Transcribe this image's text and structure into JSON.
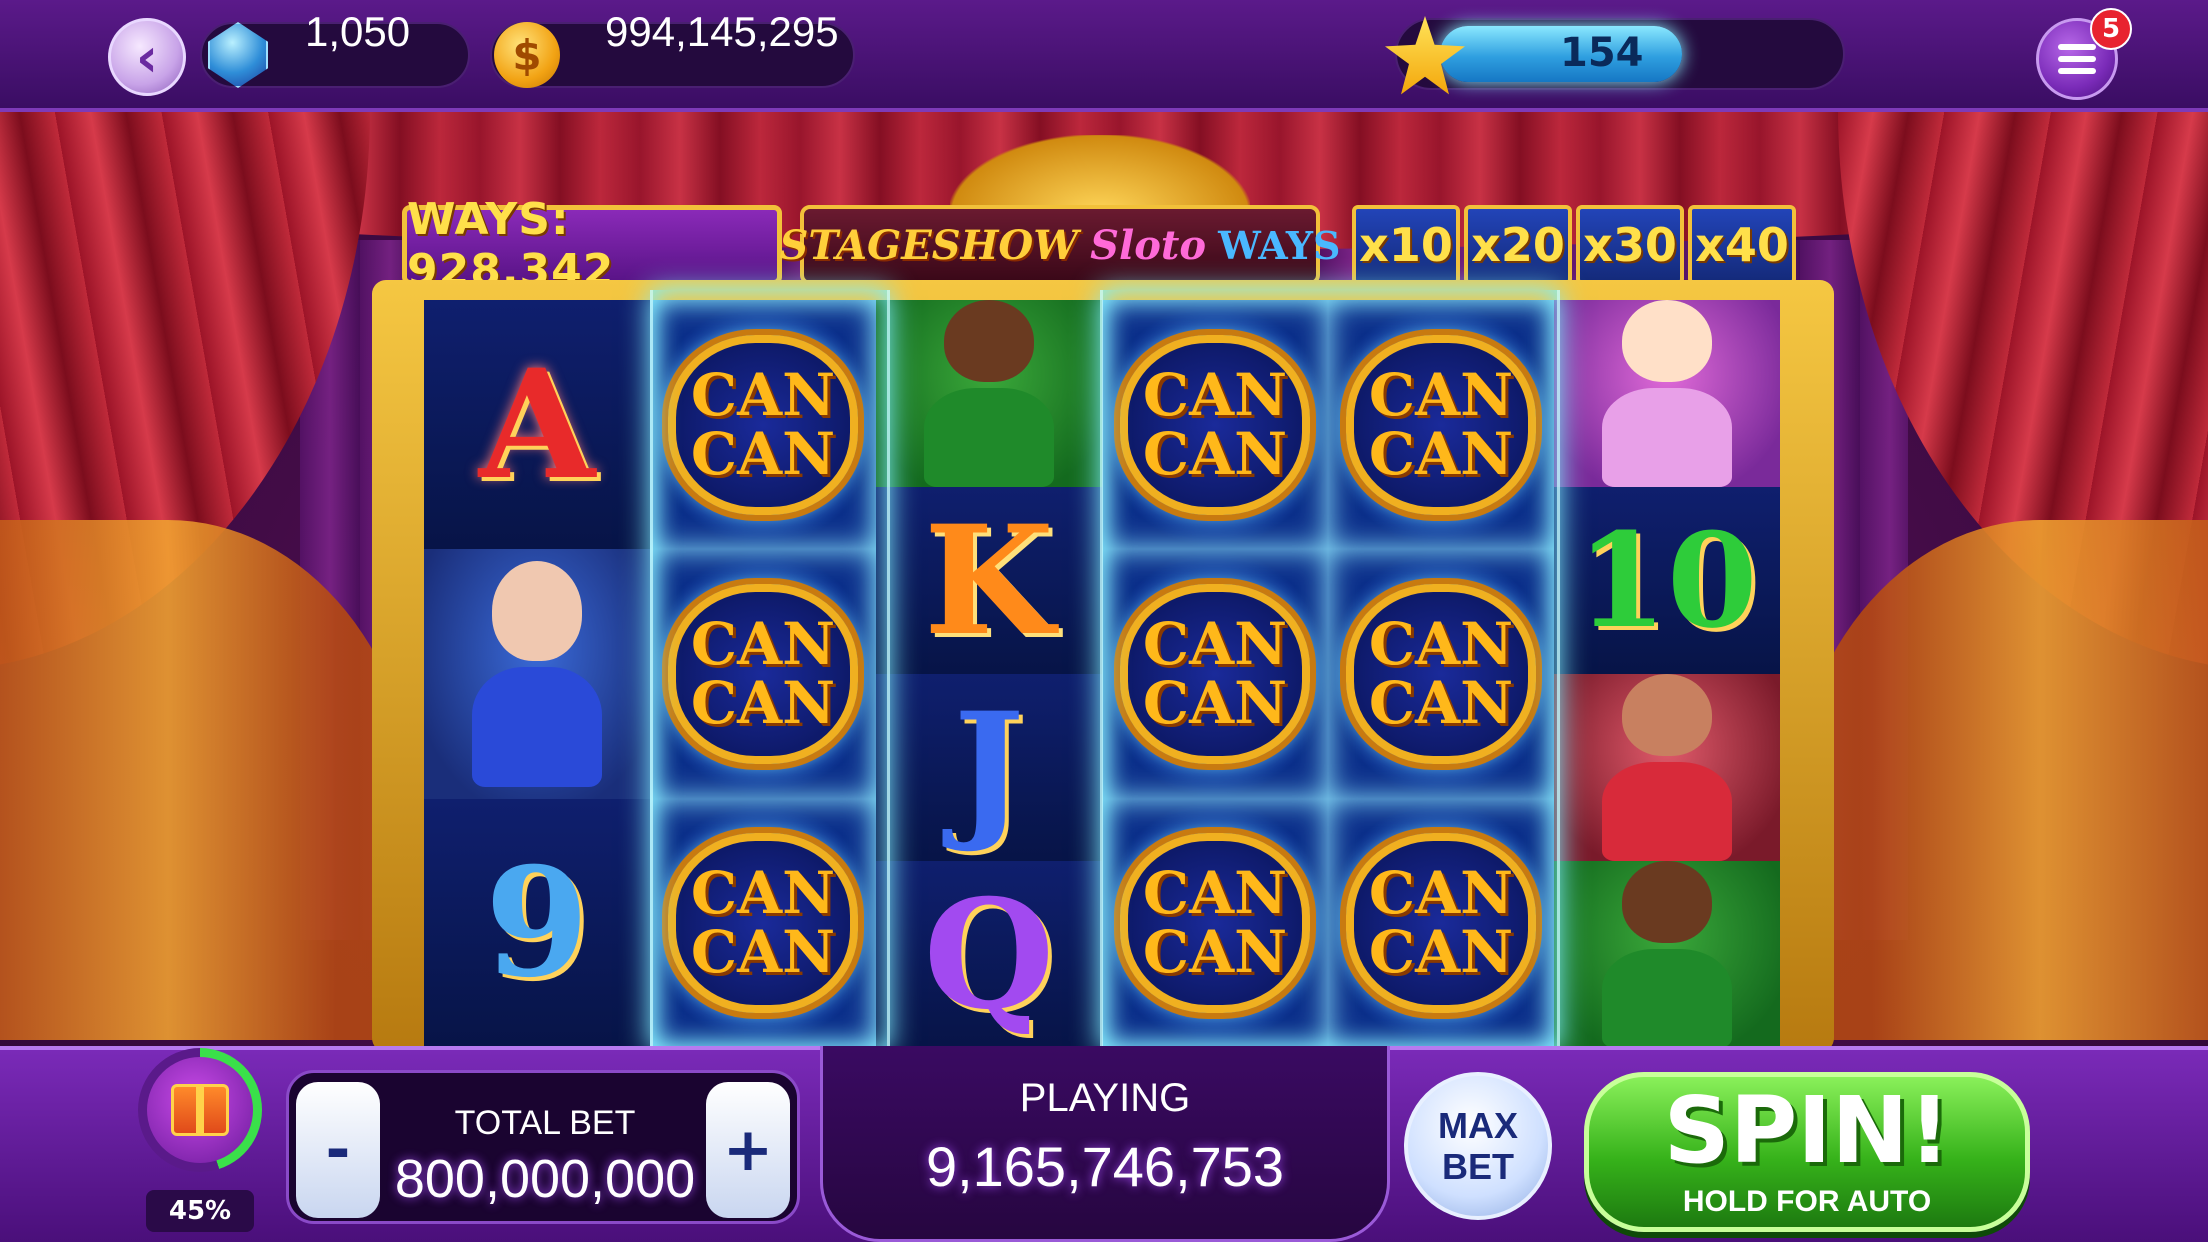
{
  "topbar": {
    "gems": "1,050",
    "coins": "994,145,295",
    "coin_symbol": "$",
    "level": "154",
    "level_progress": 0.62,
    "notifications": "5",
    "back_icon": "chevron-left-icon",
    "menu_icon": "hamburger-menu-icon"
  },
  "header": {
    "ways_text": "WAYS: 928,342",
    "title_part1": "STAGESHOW",
    "title_part2": "Sloto",
    "title_part3": "WAYS",
    "multipliers": [
      "x10",
      "x20",
      "x30",
      "x40"
    ]
  },
  "reels": {
    "can_can_word": "CAN",
    "columns": [
      [
        {
          "type": "letter",
          "text": "A"
        },
        {
          "type": "dancer",
          "color": "blue"
        },
        {
          "type": "letter",
          "text": "9"
        }
      ],
      [
        {
          "type": "cancan"
        },
        {
          "type": "cancan"
        },
        {
          "type": "cancan"
        }
      ],
      [
        {
          "type": "dancer",
          "color": "green"
        },
        {
          "type": "letter",
          "text": "K"
        },
        {
          "type": "letter",
          "text": "J"
        },
        {
          "type": "letter",
          "text": "Q"
        }
      ],
      [
        {
          "type": "cancan"
        },
        {
          "type": "cancan"
        },
        {
          "type": "cancan"
        }
      ],
      [
        {
          "type": "cancan"
        },
        {
          "type": "cancan"
        },
        {
          "type": "cancan"
        }
      ],
      [
        {
          "type": "dancer",
          "color": "pink"
        },
        {
          "type": "letter",
          "text": "10"
        },
        {
          "type": "dancer",
          "color": "red"
        },
        {
          "type": "dancer",
          "color": "green"
        }
      ]
    ]
  },
  "bottombar": {
    "gift_percent": "45%",
    "gift_progress": 0.45,
    "minus_label": "-",
    "plus_label": "+",
    "total_bet_label": "TOTAL BET",
    "total_bet_value": "800,000,000",
    "playing_label": "PLAYING",
    "playing_value": "9,165,746,753",
    "max_bet_line1": "MAX",
    "max_bet_line2": "BET",
    "spin_label": "SPIN!",
    "spin_sub": "HOLD FOR AUTO"
  },
  "colors": {
    "accent_purple": "#5b1a8a",
    "gold": "#f2c13a",
    "spin_green": "#36b21a",
    "xp_blue": "#2f9fe0"
  }
}
